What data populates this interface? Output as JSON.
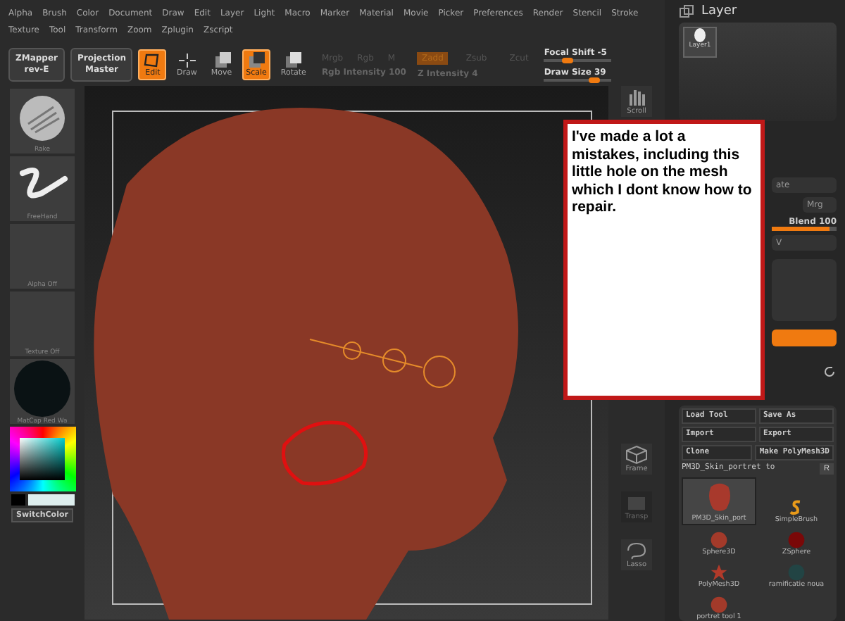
{
  "menu_rows": [
    [
      "Alpha",
      "Brush",
      "Color",
      "Document",
      "Draw",
      "Edit",
      "Layer",
      "Light",
      "Macro",
      "Marker",
      "Material",
      "Movie",
      "Picker",
      "Preferences",
      "Render",
      "Stencil",
      "Stroke"
    ],
    [
      "Texture",
      "Tool",
      "Transform",
      "Zoom",
      "Zplugin",
      "Zscript"
    ]
  ],
  "toolbar": {
    "big_buttons": [
      {
        "label": "ZMapper",
        "sub": "rev-E"
      },
      {
        "label": "Projection",
        "sub": "Master"
      }
    ],
    "tools": [
      {
        "label": "Edit",
        "kind": "edit",
        "selected": true
      },
      {
        "label": "Draw",
        "kind": "draw",
        "selected": false
      },
      {
        "label": "Move",
        "kind": "move",
        "selected": false
      },
      {
        "label": "Scale",
        "kind": "scale",
        "selected": true
      },
      {
        "label": "Rotate",
        "kind": "rotate",
        "selected": false
      }
    ],
    "rgb_labels": [
      "Mrgb",
      "Rgb",
      "M"
    ],
    "rgb_intensity": "Rgb Intensity 100",
    "z_modes": [
      {
        "label": "Zadd",
        "selected": true
      },
      {
        "label": "Zsub",
        "selected": false
      },
      {
        "label": "Zcut",
        "selected": false
      }
    ],
    "z_intensity": "Z Intensity 4",
    "focal_shift": {
      "label": "Focal Shift -5",
      "level": 0.35
    },
    "draw_size": {
      "label": "Draw Size 39",
      "level": 0.75
    }
  },
  "left_panel": {
    "slots": [
      {
        "label": "Rake",
        "kind": "rake"
      },
      {
        "label": "FreeHand",
        "kind": "stroke"
      },
      {
        "label": "Alpha Off",
        "kind": "empty"
      },
      {
        "label": "Texture Off",
        "kind": "empty"
      },
      {
        "label": "MatCap Red Wa",
        "kind": "material"
      }
    ],
    "switch_color": "SwitchColor"
  },
  "side_strip": [
    {
      "label": "Scroll",
      "kind": "hand",
      "disabled": false
    },
    {
      "label": "Frame",
      "kind": "cube",
      "disabled": false
    },
    {
      "label": "Transp",
      "kind": "layers",
      "disabled": true
    },
    {
      "label": "Lasso",
      "kind": "lasso",
      "disabled": false
    }
  ],
  "layer_panel": {
    "title": "Layer",
    "layer_name": "Layer1",
    "partial_1": "ate",
    "partial_2": "Mrg",
    "blend": {
      "label": "Blend 100",
      "level": 0.9
    },
    "partial_3": "V"
  },
  "tool_panel": {
    "buttons": [
      [
        "Load Tool",
        "Save As"
      ],
      [
        "Import",
        "Export"
      ],
      [
        "Clone",
        "Make PolyMesh3D"
      ]
    ],
    "current_tool": "PM3D_Skin_portret to",
    "r_button": "R",
    "tools": [
      {
        "label": "PM3D_Skin_port",
        "kind": "head",
        "selected": true
      },
      {
        "label": "SimpleBrush",
        "kind": "brush",
        "selected": false
      },
      {
        "label": "Sphere3D",
        "kind": "sphere",
        "selected": false
      },
      {
        "label": "ZSphere",
        "kind": "zsphere",
        "selected": false
      },
      {
        "label": "PolyMesh3D",
        "kind": "star",
        "selected": false
      },
      {
        "label": "ramificatie noua",
        "kind": "dark",
        "selected": false
      },
      {
        "label": "portret tool 1",
        "kind": "sphere",
        "selected": false
      }
    ]
  },
  "callout": "I've made a lot a mistakes, including this little hole on the mesh which I dont know how to repair."
}
